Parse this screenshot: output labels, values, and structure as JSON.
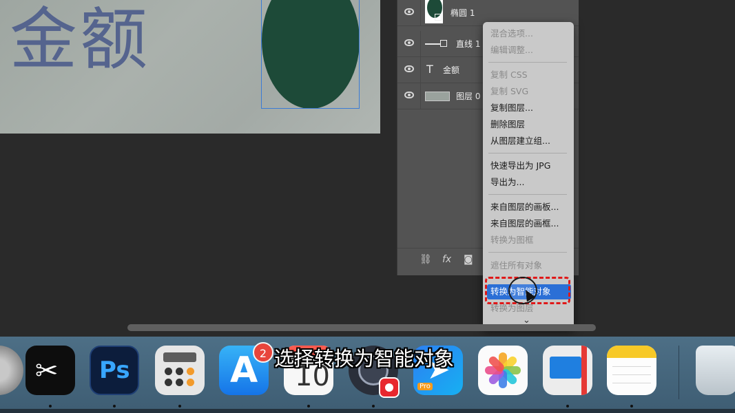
{
  "canvas": {
    "title_text": "金额",
    "colors": {
      "background": "#a3aaa6",
      "title": "#55648e",
      "ellipse": "#1d4a38",
      "selection": "#3a7bd5"
    }
  },
  "layers_panel": {
    "layers": [
      {
        "name": "椭圆 1",
        "kind": "shape-ellipse",
        "visible": true
      },
      {
        "name": "直线 1",
        "kind": "shape-line",
        "visible": true
      },
      {
        "name": "金额",
        "kind": "text",
        "visible": true
      },
      {
        "name": "图层 0",
        "kind": "raster",
        "visible": true
      }
    ],
    "footer_icons": [
      "link-icon",
      "fx-icon",
      "mask-icon"
    ],
    "footer_fx_label": "fx"
  },
  "context_menu": {
    "items": [
      {
        "label": "混合选项...",
        "disabled": true
      },
      {
        "label": "编辑调整...",
        "disabled": true
      },
      {
        "label": "复制 CSS",
        "disabled": true
      },
      {
        "label": "复制 SVG",
        "disabled": true
      },
      {
        "label": "复制图层...",
        "disabled": false
      },
      {
        "label": "删除图层",
        "disabled": false
      },
      {
        "label": "从图层建立组...",
        "disabled": false
      },
      {
        "label": "快速导出为 JPG",
        "disabled": false
      },
      {
        "label": "导出为...",
        "disabled": false
      },
      {
        "label": "来自图层的画板...",
        "disabled": false
      },
      {
        "label": "来自图层的画框...",
        "disabled": false
      },
      {
        "label": "转换为图框",
        "disabled": true
      },
      {
        "label": "遮住所有对象",
        "disabled": true
      },
      {
        "label": "转换为智能对象",
        "disabled": false,
        "highlighted": true
      },
      {
        "label": "转换为图层",
        "disabled": true
      }
    ],
    "more_indicator": "⌄",
    "highlight_color": "#2b6fd6",
    "annotation_color": "#e01818"
  },
  "dock": {
    "apps": [
      "settings-app",
      "capcut-app",
      "photoshop-app",
      "calculator-app",
      "app-store-app",
      "calendar-app",
      "obs-app",
      "pro-app",
      "photos-app",
      "remote-desktop-app",
      "notes-app",
      "trash"
    ],
    "ps_label": "Ps",
    "app_store_badge": "2",
    "calendar_day": "10",
    "pro_label": "Pro"
  },
  "subtitle": "选择转换为智能对象"
}
